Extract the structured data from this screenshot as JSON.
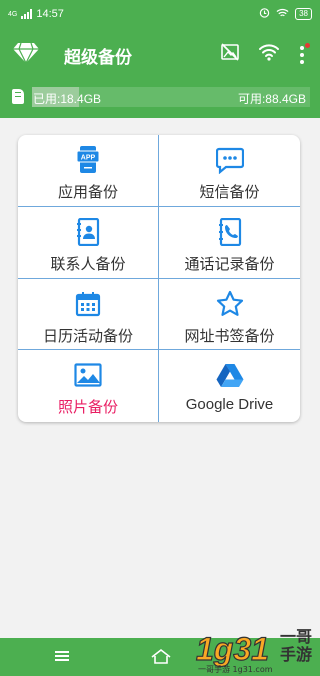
{
  "status": {
    "network": "4G",
    "time": "14:57",
    "battery": "38"
  },
  "app": {
    "title": "超级备份"
  },
  "storage": {
    "used_label": "已用:18.4GB",
    "available_label": "可用:88.4GB",
    "used_fraction": 0.17
  },
  "menu": [
    {
      "label": "应用备份",
      "icon": "app-icon"
    },
    {
      "label": "短信备份",
      "icon": "sms-icon"
    },
    {
      "label": "联系人备份",
      "icon": "contacts-icon"
    },
    {
      "label": "通话记录备份",
      "icon": "call-log-icon"
    },
    {
      "label": "日历活动备份",
      "icon": "calendar-icon"
    },
    {
      "label": "网址书签备份",
      "icon": "star-icon"
    },
    {
      "label": "照片备份",
      "icon": "photo-icon"
    },
    {
      "label": "Google Drive",
      "icon": "google-drive-icon"
    }
  ],
  "watermark": {
    "brand": "1g31",
    "text_top": "一哥",
    "text_bottom": "手游",
    "url": "一哥手游 1g31.com"
  },
  "colors": {
    "primary": "#4caf50",
    "icon_blue": "#1e88e5",
    "divider": "#6fa8dc",
    "highlight": "#e91e63"
  }
}
